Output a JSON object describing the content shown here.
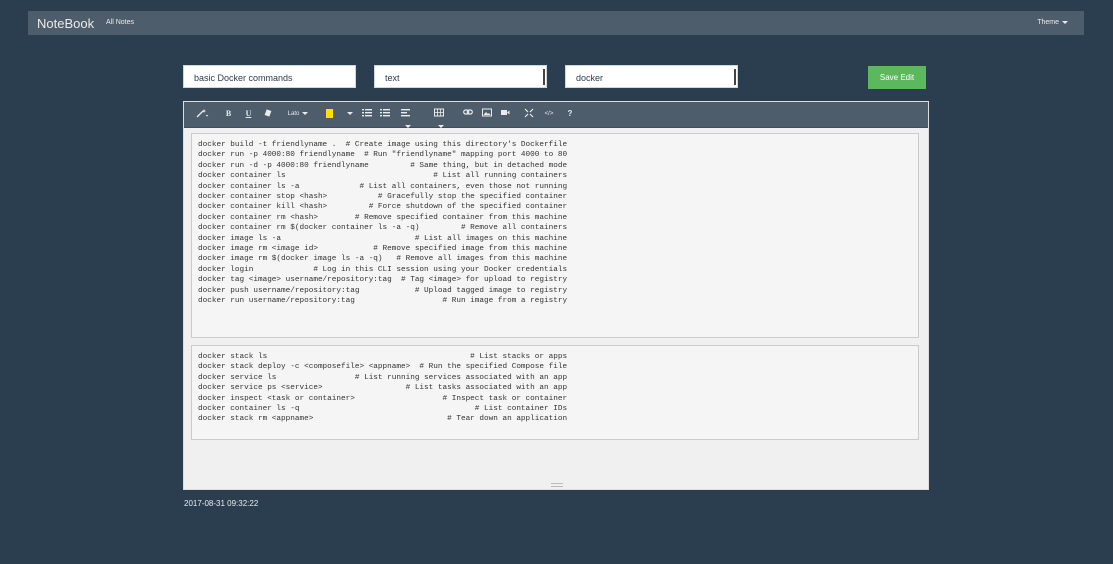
{
  "navbar": {
    "brand": "NoteBook",
    "all_notes": "All Notes",
    "theme": "Theme"
  },
  "form": {
    "title_value": "basic Docker commands",
    "type_value": "text",
    "tag_value": "docker",
    "save_label": "Save Edit"
  },
  "toolbar": {
    "font_name": "Lato",
    "bold": "B",
    "underline": "U",
    "help": "?",
    "code_view": "</>",
    "items": [
      "magic-wand-icon",
      "bold",
      "underline",
      "eraser-icon",
      "font-name",
      "highlight-color",
      "unordered-list-icon",
      "ordered-list-icon",
      "paragraph-align-icon",
      "table-icon",
      "link-icon",
      "picture-icon",
      "video-icon",
      "fullscreen-icon",
      "code-view",
      "help"
    ]
  },
  "blocks": [
    "docker build -t friendlyname .  # Create image using this directory's Dockerfile\ndocker run -p 4000:80 friendlyname  # Run \"friendlyname\" mapping port 4000 to 80\ndocker run -d -p 4000:80 friendlyname         # Same thing, but in detached mode\ndocker container ls                                # List all running containers\ndocker container ls -a             # List all containers, even those not running\ndocker container stop <hash>           # Gracefully stop the specified container\ndocker container kill <hash>         # Force shutdown of the specified container\ndocker container rm <hash>        # Remove specified container from this machine\ndocker container rm $(docker container ls -a -q)         # Remove all containers\ndocker image ls -a                             # List all images on this machine\ndocker image rm <image id>            # Remove specified image from this machine\ndocker image rm $(docker image ls -a -q)   # Remove all images from this machine\ndocker login             # Log in this CLI session using your Docker credentials\ndocker tag <image> username/repository:tag  # Tag <image> for upload to registry\ndocker push username/repository:tag            # Upload tagged image to registry\ndocker run username/repository:tag                   # Run image from a registry",
    "docker stack ls                                            # List stacks or apps\ndocker stack deploy -c <composefile> <appname>  # Run the specified Compose file\ndocker service ls                 # List running services associated with an app\ndocker service ps <service>                  # List tasks associated with an app\ndocker inspect <task or container>                   # Inspect task or container\ndocker container ls -q                                      # List container IDs\ndocker stack rm <appname>                             # Tear down an application"
  ],
  "timestamp": "2017-08-31 09:32:22",
  "colors": {
    "background": "#2b3e50",
    "navbar": "#4e5d6c",
    "save_button": "#5cb85c",
    "highlight": "#ffe000"
  }
}
